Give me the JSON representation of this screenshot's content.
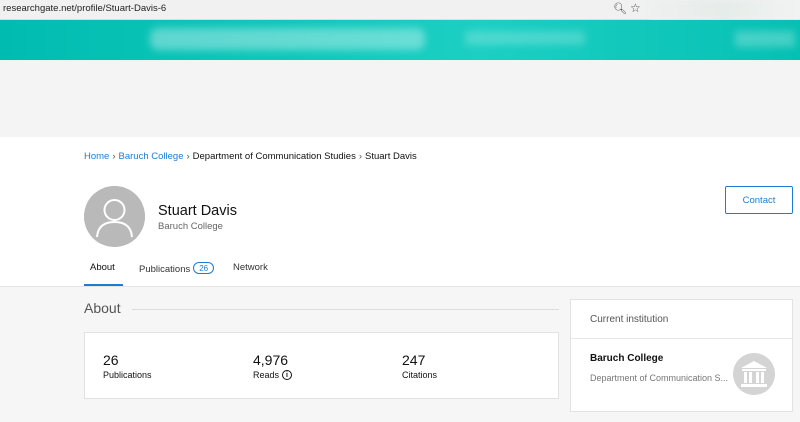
{
  "browser": {
    "url": "researchgate.net/profile/Stuart-Davis-6",
    "zoom_icon": "zoom-icon",
    "star_icon": "bookmark-star-icon"
  },
  "breadcrumb": {
    "items": [
      "Home",
      "Baruch College",
      "Department of Communication Studies",
      "Stuart Davis"
    ]
  },
  "profile": {
    "name": "Stuart Davis",
    "institution": "Baruch College",
    "contact_label": "Contact"
  },
  "tabs": [
    {
      "label": "About",
      "active": true
    },
    {
      "label": "Publications",
      "badge": "26"
    },
    {
      "label": "Network"
    }
  ],
  "about": {
    "title": "About",
    "stats": [
      {
        "value": "26",
        "label": "Publications"
      },
      {
        "value": "4,976",
        "label": "Reads"
      },
      {
        "value": "247",
        "label": "Citations"
      }
    ]
  },
  "current_institution": {
    "header": "Current institution",
    "name": "Baruch College",
    "department": "Department of Communication S..."
  },
  "colors": {
    "accent": "#1c7cd6",
    "header_teal": "#00bcb0"
  }
}
